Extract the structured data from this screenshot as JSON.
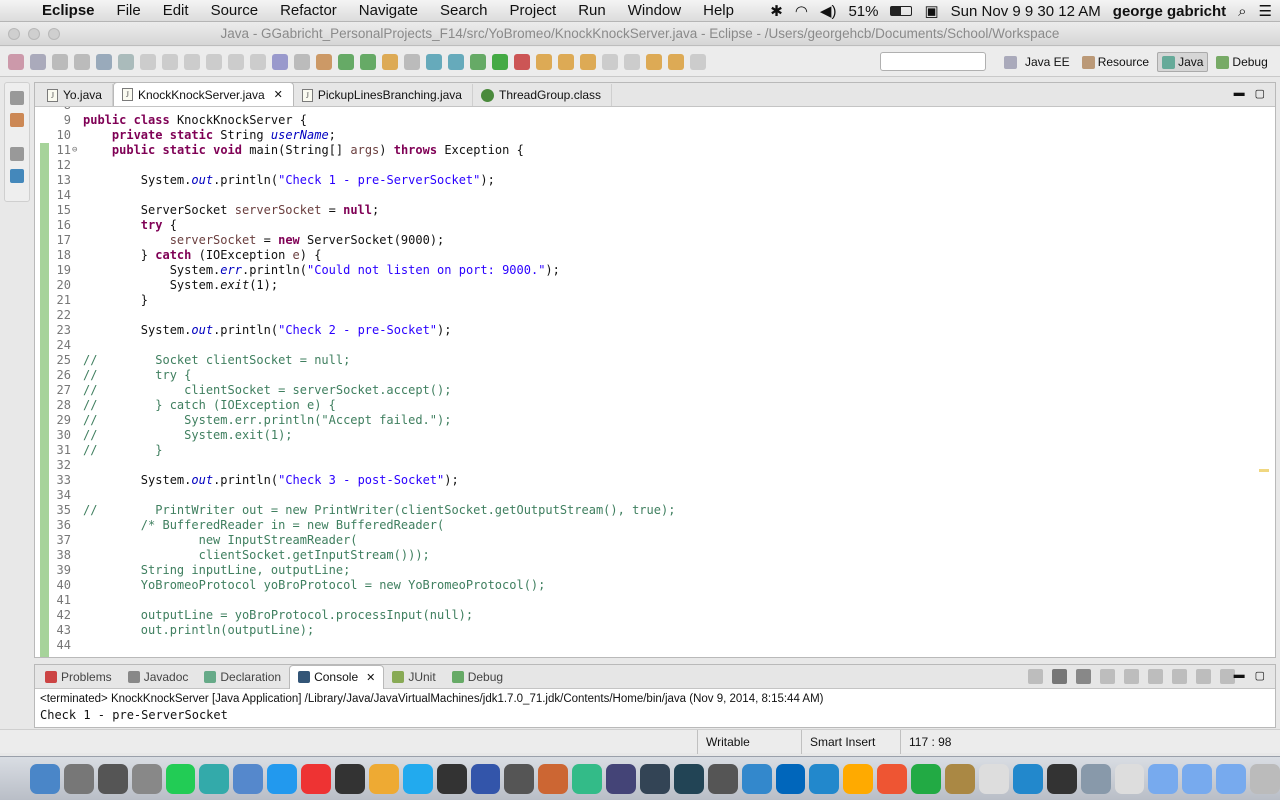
{
  "menubar": {
    "apple_glyph": "",
    "app_name": "Eclipse",
    "items": [
      "File",
      "Edit",
      "Source",
      "Refactor",
      "Navigate",
      "Search",
      "Project",
      "Run",
      "Window",
      "Help"
    ],
    "battery": "51%",
    "clock": "Sun Nov 9  9 30 12 AM",
    "user": "george gabricht"
  },
  "window": {
    "title": "Java - GGabricht_PersonalProjects_F14/src/YoBromeo/KnockKnockServer.java - Eclipse - /Users/georgehcb/Documents/School/Workspace"
  },
  "perspectives": [
    {
      "label": "Java EE",
      "active": false
    },
    {
      "label": "Resource",
      "active": false
    },
    {
      "label": "Java",
      "active": true
    },
    {
      "label": "Debug",
      "active": false
    }
  ],
  "editor": {
    "tabs": [
      {
        "label": "Yo.java",
        "icon": "java-file-icon",
        "active": false
      },
      {
        "label": "KnockKnockServer.java",
        "icon": "java-file-icon",
        "active": true
      },
      {
        "label": "PickupLinesBranching.java",
        "icon": "java-file-icon",
        "active": false
      },
      {
        "label": "ThreadGroup.class",
        "icon": "class-file-icon",
        "active": false
      }
    ],
    "lines": [
      {
        "n": "8",
        "html": ""
      },
      {
        "n": "9",
        "html": "<span class='kw'>public</span> <span class='kw'>class</span> KnockKnockServer {"
      },
      {
        "n": "10",
        "html": "    <span class='kw'>private</span> <span class='kw'>static</span> String <span class='fld'>userName</span>;"
      },
      {
        "n": "11",
        "fold": true,
        "html": "    <span class='kw'>public</span> <span class='kw'>static</span> <span class='kw'>void</span> main(String[] <span class='var'>args</span>) <span class='kw'>throws</span> Exception {"
      },
      {
        "n": "12",
        "html": ""
      },
      {
        "n": "13",
        "html": "        System.<span class='fld'>out</span>.println(<span class='str'>\"Check 1 - pre-ServerSocket\"</span>);"
      },
      {
        "n": "14",
        "html": ""
      },
      {
        "n": "15",
        "html": "        ServerSocket <span class='var'>serverSocket</span> = <span class='kw'>null</span>;"
      },
      {
        "n": "16",
        "html": "        <span class='kw'>try</span> {"
      },
      {
        "n": "17",
        "html": "            <span class='var'>serverSocket</span> = <span class='kw'>new</span> ServerSocket(9000);"
      },
      {
        "n": "18",
        "html": "        } <span class='kw'>catch</span> (IOException <span class='var'>e</span>) {"
      },
      {
        "n": "19",
        "html": "            System.<span class='fld'>err</span>.println(<span class='str'>\"Could not listen on port: 9000.\"</span>);"
      },
      {
        "n": "20",
        "html": "            System.<i>exit</i>(1);"
      },
      {
        "n": "21",
        "html": "        }"
      },
      {
        "n": "22",
        "html": ""
      },
      {
        "n": "23",
        "html": "        System.<span class='fld'>out</span>.println(<span class='str'>\"Check 2 - pre-Socket\"</span>);"
      },
      {
        "n": "24",
        "html": ""
      },
      {
        "n": "25",
        "html": "<span class='cm'>//        Socket clientSocket = null;</span>"
      },
      {
        "n": "26",
        "html": "<span class='cm'>//        try {</span>"
      },
      {
        "n": "27",
        "html": "<span class='cm'>//            clientSocket = serverSocket.accept();</span>"
      },
      {
        "n": "28",
        "html": "<span class='cm'>//        } catch (IOException e) {</span>"
      },
      {
        "n": "29",
        "html": "<span class='cm'>//            System.err.println(\"Accept failed.\");</span>"
      },
      {
        "n": "30",
        "html": "<span class='cm'>//            System.exit(1);</span>"
      },
      {
        "n": "31",
        "html": "<span class='cm'>//        }</span>"
      },
      {
        "n": "32",
        "html": ""
      },
      {
        "n": "33",
        "html": "        System.<span class='fld'>out</span>.println(<span class='str'>\"Check 3 - post-Socket\"</span>);"
      },
      {
        "n": "34",
        "html": ""
      },
      {
        "n": "35",
        "html": "<span class='cm'>//        PrintWriter out = new PrintWriter(clientSocket.getOutputStream(), true);</span>"
      },
      {
        "n": "36",
        "html": "        <span class='cm'>/* BufferedReader in = new BufferedReader(</span>"
      },
      {
        "n": "37",
        "html": "<span class='cm'>                new InputStreamReader(</span>"
      },
      {
        "n": "38",
        "html": "<span class='cm'>                clientSocket.getInputStream()));</span>"
      },
      {
        "n": "39",
        "html": "<span class='cm'>        String inputLine, outputLine;</span>"
      },
      {
        "n": "40",
        "html": "<span class='cm'>        YoBromeoProtocol yoBroProtocol = new YoBromeoProtocol();</span>"
      },
      {
        "n": "41",
        "html": ""
      },
      {
        "n": "42",
        "html": "<span class='cm'>        outputLine = yoBroProtocol.processInput(null);</span>"
      },
      {
        "n": "43",
        "html": "<span class='cm'>        out.println(outputLine);</span>"
      },
      {
        "n": "44",
        "html": ""
      }
    ]
  },
  "bottom": {
    "tabs": [
      {
        "label": "Problems",
        "active": false,
        "color": "#c44"
      },
      {
        "label": "Javadoc",
        "active": false,
        "color": "#888"
      },
      {
        "label": "Declaration",
        "active": false,
        "color": "#6a8"
      },
      {
        "label": "Console",
        "active": true,
        "color": "#357"
      },
      {
        "label": "JUnit",
        "active": false,
        "color": "#8a5"
      },
      {
        "label": "Debug",
        "active": false,
        "color": "#6a6"
      }
    ],
    "terminated": "<terminated> KnockKnockServer [Java Application] /Library/Java/JavaVirtualMachines/jdk1.7.0_71.jdk/Contents/Home/bin/java (Nov 9, 2014, 8:15:44 AM)",
    "output": "Check 1 - pre-ServerSocket"
  },
  "status": {
    "writable": "Writable",
    "insert_mode": "Smart Insert",
    "position": "117 : 98"
  },
  "dock_colors": [
    "#4a86c8",
    "#777",
    "#555",
    "#888",
    "#2c5",
    "#3aa",
    "#58c",
    "#29e",
    "#e33",
    "#333",
    "#ea3",
    "#2ae",
    "#333",
    "#35a",
    "#555",
    "#c63",
    "#3b8",
    "#447",
    "#345",
    "#245",
    "#555",
    "#38c",
    "#06b",
    "#28c",
    "#fa0",
    "#e53",
    "#2a4",
    "#a84",
    "#ddd",
    "#28c",
    "#333",
    "#89a",
    "#ddd",
    "#7ae",
    "#7ae",
    "#7ae",
    "#bbb"
  ]
}
